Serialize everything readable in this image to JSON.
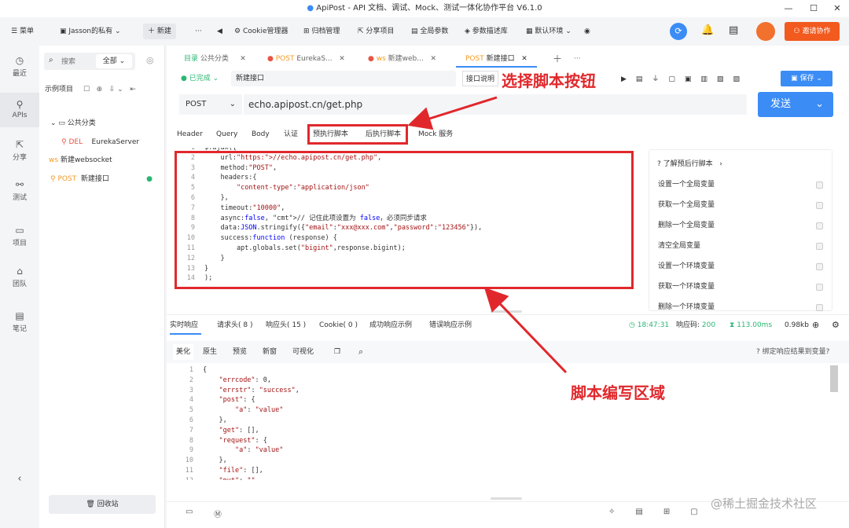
{
  "window": {
    "title": "ApiPost - API 文档、调试、Mock、测试一体化协作平台 V6.1.0"
  },
  "toolbar": {
    "menu": "菜单",
    "workspace": "Jasson的私有",
    "new": "新建",
    "cookie": "Cookie管理器",
    "archive": "归档管理",
    "share": "分享项目",
    "global_params": "全局参数",
    "param_desc": "参数描述库",
    "default_env": "默认环境",
    "invite": "邀请协作"
  },
  "sidebar": {
    "items": [
      {
        "icon": "clock-icon",
        "label": "最近"
      },
      {
        "icon": "api-icon",
        "label": "APIs"
      },
      {
        "icon": "share-icon",
        "label": "分享"
      },
      {
        "icon": "test-icon",
        "label": "测试"
      },
      {
        "icon": "project-icon",
        "label": "项目"
      },
      {
        "icon": "team-icon",
        "label": "团队"
      },
      {
        "icon": "note-icon",
        "label": "笔记"
      }
    ]
  },
  "tree": {
    "search_placeholder": "搜索",
    "filter": "全部",
    "project": "示例项目",
    "folder": "公共分类",
    "items": [
      {
        "method": "DEL",
        "name": "EurekaServer"
      },
      {
        "method": "ws",
        "name": "新建websocket"
      },
      {
        "method": "POST",
        "name": "新建接口"
      }
    ],
    "recycle": "回收站"
  },
  "tabs": [
    {
      "prefix": "目录",
      "label": "公共分类"
    },
    {
      "prefix": "POST",
      "label": "EurekaS..."
    },
    {
      "prefix": "ws",
      "label": "新建web..."
    },
    {
      "prefix": "POST",
      "label": "新建接口"
    }
  ],
  "request": {
    "status": "已完成",
    "name": "新建接口",
    "doc_btn": "接口说明",
    "save": "保存",
    "method": "POST",
    "url": "echo.apipost.cn/get.php",
    "send": "发送"
  },
  "req_tabs": [
    "Header",
    "Query",
    "Body",
    "认证",
    "预执行脚本",
    "后执行脚本",
    "Mock 服务"
  ],
  "script_lines": [
    {
      "n": "1",
      "t": "$.ajax({"
    },
    {
      "n": "2",
      "t": "    url:\"https://echo.apipost.cn/get.php\","
    },
    {
      "n": "3",
      "t": "    method:\"POST\","
    },
    {
      "n": "4",
      "t": "    headers:{"
    },
    {
      "n": "5",
      "t": "        \"content-type\":\"application/json\""
    },
    {
      "n": "6",
      "t": "    },"
    },
    {
      "n": "7",
      "t": "    timeout:\"10000\","
    },
    {
      "n": "8",
      "t": "    async:false, // 记住此项设置为 false，必须同步请求"
    },
    {
      "n": "9",
      "t": "    data:JSON.stringify({\"email\":\"xxx@xxx.com\",\"password\":\"123456\"}),"
    },
    {
      "n": "10",
      "t": "    success:function (response) {"
    },
    {
      "n": "11",
      "t": "        apt.globals.set(\"bigint\",response.bigint);"
    },
    {
      "n": "12",
      "t": "    }"
    },
    {
      "n": "13",
      "t": "}"
    },
    {
      "n": "14",
      "t": ");"
    }
  ],
  "hints": {
    "title": "了解预后行脚本",
    "items": [
      "设置一个全局变量",
      "获取一个全局变量",
      "删除一个全局变量",
      "清空全局变量",
      "设置一个环境变量",
      "获取一个环境变量",
      "删除一个环境变量"
    ]
  },
  "response": {
    "tabs": [
      "实时响应",
      "请求头( 8 )",
      "响应头( 15 )",
      "Cookie( 0 )",
      "成功响应示例",
      "错误响应示例"
    ],
    "time": "18:47:31",
    "code_label": "响应码:",
    "code": "200",
    "duration": "113.00ms",
    "size": "0.98kb",
    "sub_tabs": [
      "美化",
      "原生",
      "预览",
      "新窗",
      "可视化"
    ],
    "bind": "绑定响应结果到变量?",
    "lines": [
      {
        "n": "1",
        "t": "{"
      },
      {
        "n": "2",
        "t": "    \"errcode\": 0,"
      },
      {
        "n": "3",
        "t": "    \"errstr\": \"success\","
      },
      {
        "n": "4",
        "t": "    \"post\": {"
      },
      {
        "n": "5",
        "t": "        \"a\": \"value\""
      },
      {
        "n": "6",
        "t": "    },"
      },
      {
        "n": "7",
        "t": "    \"get\": [],"
      },
      {
        "n": "8",
        "t": "    \"request\": {"
      },
      {
        "n": "9",
        "t": "        \"a\": \"value\""
      },
      {
        "n": "10",
        "t": "    },"
      },
      {
        "n": "11",
        "t": "    \"file\": [],"
      },
      {
        "n": "12",
        "t": "    \"put\": \"\""
      }
    ]
  },
  "annotations": {
    "button": "选择脚本按钮",
    "area": "脚本编写区域"
  },
  "watermark": "@稀土掘金技术社区",
  "colors": {
    "accent": "#3b8cf5",
    "annotation": "#e0282c",
    "post": "#f49b26",
    "del": "#e85445",
    "invite": "#f25a1e"
  }
}
